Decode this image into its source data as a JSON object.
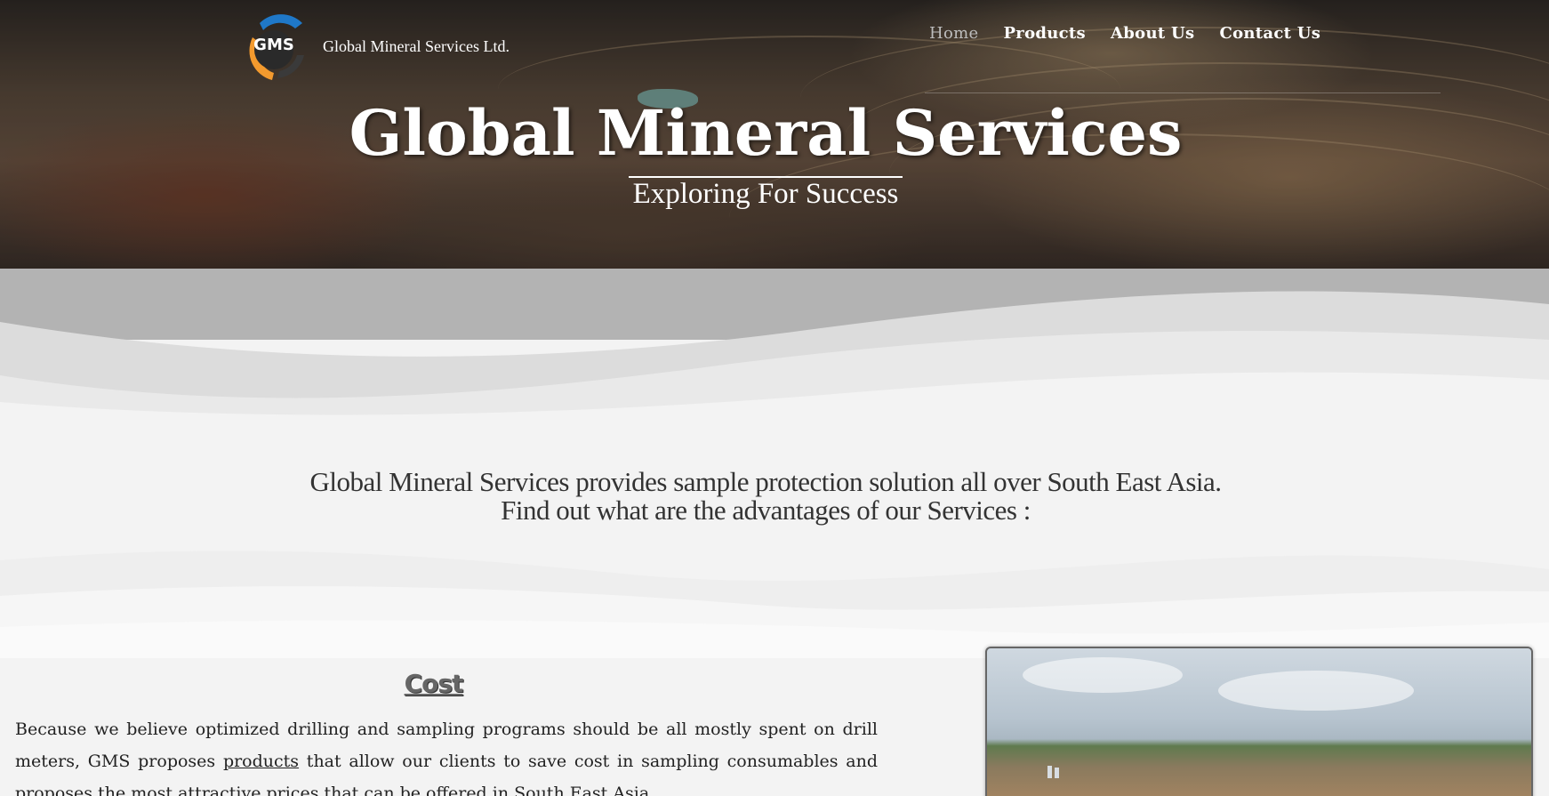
{
  "header": {
    "logo_text": "GMS",
    "company_name": "Global Mineral Services Ltd.",
    "nav": [
      {
        "label": "Home",
        "active": true
      },
      {
        "label": "Products",
        "active": false
      },
      {
        "label": "About Us",
        "active": false
      },
      {
        "label": "Contact Us",
        "active": false
      }
    ]
  },
  "hero": {
    "title": "Global Mineral Services",
    "subtitle": "Exploring For Success"
  },
  "intro": {
    "line1": "Global Mineral Services provides sample protection solution all over South East Asia.",
    "line2": "Find out what are the advantages of our Services :"
  },
  "cost": {
    "title": "Cost",
    "text_before": "Because we believe optimized drilling and sampling programs should be all mostly spent on drill meters, GMS proposes ",
    "link": "products",
    "text_after": " that allow our clients to save cost in sampling consumables and proposes the most attractive prices that can be offered in South East Asia."
  },
  "colors": {
    "logo_blue": "#1f78c8",
    "logo_orange": "#f39a2e",
    "page_bg": "#f3f3f3",
    "text": "#333333"
  }
}
